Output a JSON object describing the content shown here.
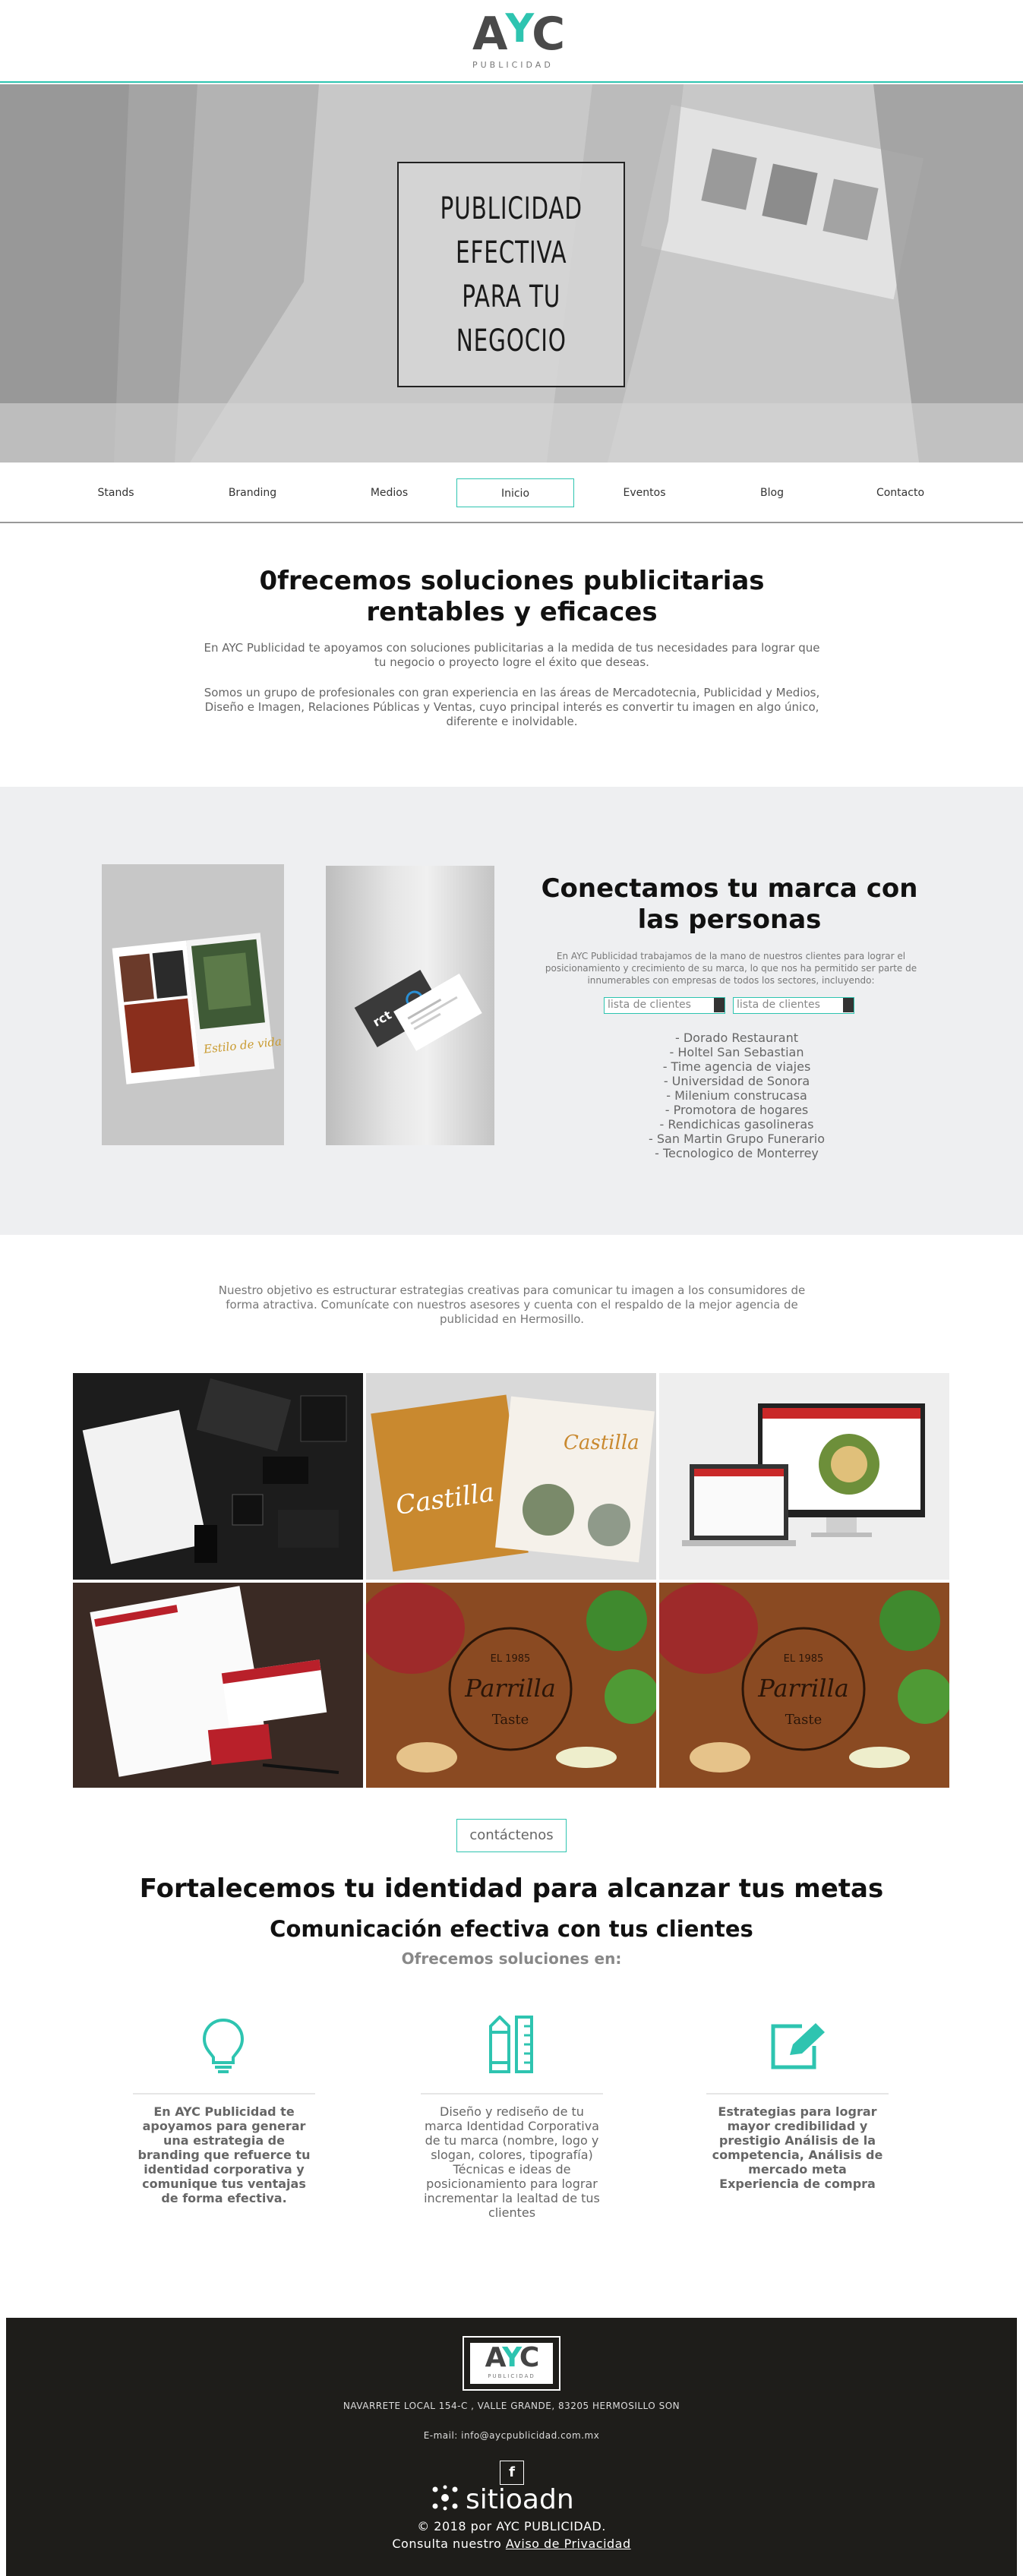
{
  "header": {
    "logo_main": "A",
    "logo_apos": "Y",
    "logo_end": "C",
    "logo_sub": "PUBLICIDAD"
  },
  "hero": {
    "title": "PUBLICIDAD\nEFECTIVA\nPARA TU\nNEGOCIO"
  },
  "nav": {
    "items": [
      "Stands",
      "Branding",
      "Medios",
      "Inicio",
      "Eventos",
      "Blog",
      "Contacto"
    ],
    "active": "Inicio"
  },
  "intro": {
    "title": "0frecemos soluciones publicitarias rentables y eficaces",
    "p1": "En AYC Publicidad te apoyamos con soluciones publicitarias a la medida de tus necesidades para lograr que tu negocio o proyecto logre el éxito que deseas.",
    "p2": "Somos un grupo de profesionales con gran experiencia en las áreas de Mercadotecnia, Publicidad y Medios, Diseño e Imagen, Relaciones Públicas y Ventas, cuyo principal interés es convertir tu imagen en algo único, diferente e inolvidable."
  },
  "connect": {
    "title": "Conectamos tu marca con las personas",
    "p": "En AYC Publicidad trabajamos de la mano de nuestros clientes para lograr el posicionamiento y crecimiento de su marca, lo que nos ha permitido ser parte de innumerables con empresas de todos los sectores, incluyendo:",
    "select1": "lista de clientes",
    "select2": "lista de clientes",
    "clients": [
      "-  Dorado Restaurant",
      "-  Holtel San Sebastian",
      "- Time agencia de viajes",
      "- Universidad de Sonora",
      "-  Milenium construcasa",
      "- Promotora de hogares",
      "- Rendichicas gasolineras",
      "- San Martin Grupo Funerario",
      "- Tecnologico de Monterrey"
    ]
  },
  "objective": "Nuestro objetivo es estructurar estrategias creativas para comunicar tu imagen a los consumidores de forma atractiva. Comunícate con nuestros asesores y cuenta con el respaldo de la mejor agencia de publicidad en Hermosillo.",
  "portfolio": {
    "castilla": "Castilla",
    "parrilla": "Parrilla",
    "taste": "Taste",
    "est": "EL  1985"
  },
  "cta": {
    "button": "contáctenos",
    "title": "Fortalecemos tu identidad para alcanzar tus metas",
    "subtitle": "Comunicación efectiva con tus clientes",
    "offer": "Ofrecemos soluciones en:"
  },
  "features": [
    {
      "icon": "lightbulb-icon",
      "text": "En AYC Publicidad te apoyamos para generar una estrategia de branding que refuerce tu identidad corporativa y comunique tus ventajas de forma efectiva."
    },
    {
      "icon": "pencil-ruler-icon",
      "text": "Diseño y rediseño de tu marca Identidad Corporativa de tu marca (nombre, logo y slogan, colores, tipografía) Técnicas e ideas de posicionamiento para lograr incrementar la lealtad de tus clientes"
    },
    {
      "icon": "edit-icon",
      "text": "Estrategias para lograr mayor credibilidad y prestigio Análisis de la competencia, Análisis de mercado meta Experiencia de compra"
    }
  ],
  "footer": {
    "logo_main": "A",
    "logo_apos": "Y",
    "logo_end": "C",
    "logo_sub": "PUBLICIDAD",
    "address": "NAVARRETE LOCAL 154-C , VALLE GRANDE, 83205 HERMOSILLO SON",
    "email": "E-mail: info@aycpublicidad.com.mx",
    "fb": "f",
    "brand": "sitioadn",
    "copyright": "© 2018 por AYC PUBLICIDAD.",
    "consult": "Consulta nuestro ",
    "privacy": "Aviso de Privacidad"
  },
  "colors": {
    "accent": "#2ec4b0",
    "footer_bg": "#1e1d1a",
    "gray_section": "#eeeff1"
  }
}
